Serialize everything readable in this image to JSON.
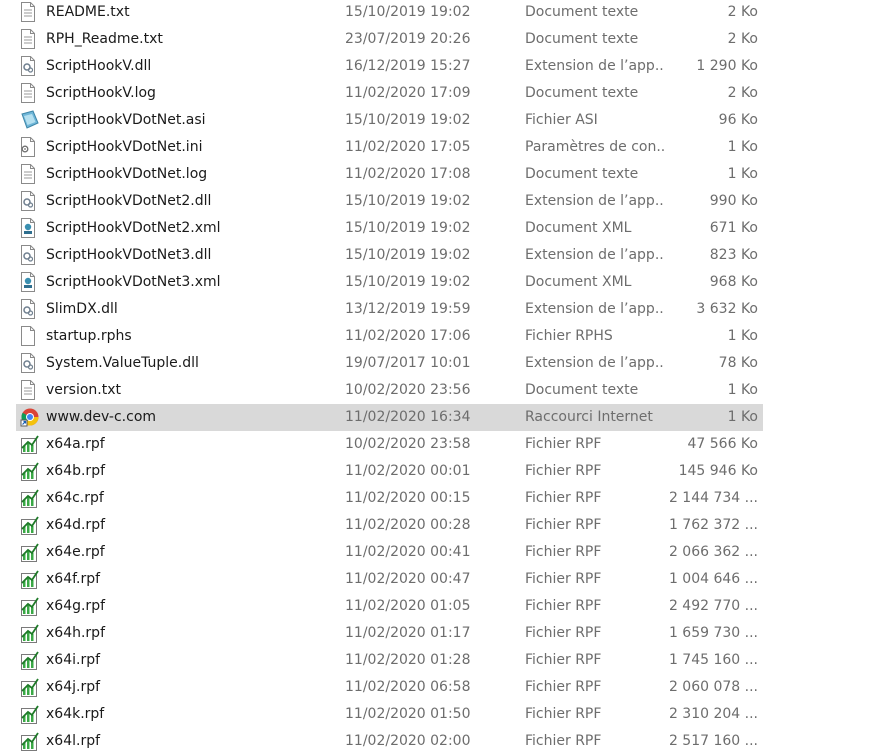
{
  "files": [
    {
      "name": "README.txt",
      "date": "15/10/2019 19:02",
      "type": "Document texte",
      "size": "2 Ko",
      "icon": "text-file-icon"
    },
    {
      "name": "RPH_Readme.txt",
      "date": "23/07/2019 20:26",
      "type": "Document texte",
      "size": "2 Ko",
      "icon": "text-file-icon"
    },
    {
      "name": "ScriptHookV.dll",
      "date": "16/12/2019 15:27",
      "type": "Extension de l’app...",
      "size": "1 290 Ko",
      "icon": "dll-file-icon"
    },
    {
      "name": "ScriptHookV.log",
      "date": "11/02/2020 17:09",
      "type": "Document texte",
      "size": "2 Ko",
      "icon": "text-file-icon"
    },
    {
      "name": "ScriptHookVDotNet.asi",
      "date": "15/10/2019 19:02",
      "type": "Fichier ASI",
      "size": "96 Ko",
      "icon": "asi-file-icon"
    },
    {
      "name": "ScriptHookVDotNet.ini",
      "date": "11/02/2020 17:05",
      "type": "Paramètres de con...",
      "size": "1 Ko",
      "icon": "ini-file-icon"
    },
    {
      "name": "ScriptHookVDotNet.log",
      "date": "11/02/2020 17:08",
      "type": "Document texte",
      "size": "1 Ko",
      "icon": "text-file-icon"
    },
    {
      "name": "ScriptHookVDotNet2.dll",
      "date": "15/10/2019 19:02",
      "type": "Extension de l’app...",
      "size": "990 Ko",
      "icon": "dll-file-icon"
    },
    {
      "name": "ScriptHookVDotNet2.xml",
      "date": "15/10/2019 19:02",
      "type": "Document XML",
      "size": "671 Ko",
      "icon": "xml-file-icon"
    },
    {
      "name": "ScriptHookVDotNet3.dll",
      "date": "15/10/2019 19:02",
      "type": "Extension de l’app...",
      "size": "823 Ko",
      "icon": "dll-file-icon"
    },
    {
      "name": "ScriptHookVDotNet3.xml",
      "date": "15/10/2019 19:02",
      "type": "Document XML",
      "size": "968 Ko",
      "icon": "xml-file-icon"
    },
    {
      "name": "SlimDX.dll",
      "date": "13/12/2019 19:59",
      "type": "Extension de l’app...",
      "size": "3 632 Ko",
      "icon": "dll-file-icon"
    },
    {
      "name": "startup.rphs",
      "date": "11/02/2020 17:06",
      "type": "Fichier RPHS",
      "size": "1 Ko",
      "icon": "blank-file-icon"
    },
    {
      "name": "System.ValueTuple.dll",
      "date": "19/07/2017 10:01",
      "type": "Extension de l’app...",
      "size": "78 Ko",
      "icon": "dll-file-icon"
    },
    {
      "name": "version.txt",
      "date": "10/02/2020 23:56",
      "type": "Document texte",
      "size": "1 Ko",
      "icon": "text-file-icon"
    },
    {
      "name": "www.dev-c.com",
      "date": "11/02/2020 16:34",
      "type": "Raccourci Internet",
      "size": "1 Ko",
      "icon": "chrome-shortcut-icon",
      "selected": true
    },
    {
      "name": "x64a.rpf",
      "date": "10/02/2020 23:58",
      "type": "Fichier RPF",
      "size": "47 566 Ko",
      "icon": "rpf-file-icon"
    },
    {
      "name": "x64b.rpf",
      "date": "11/02/2020 00:01",
      "type": "Fichier RPF",
      "size": "145 946 Ko",
      "icon": "rpf-file-icon"
    },
    {
      "name": "x64c.rpf",
      "date": "11/02/2020 00:15",
      "type": "Fichier RPF",
      "size": "2 144 734 ...",
      "icon": "rpf-file-icon"
    },
    {
      "name": "x64d.rpf",
      "date": "11/02/2020 00:28",
      "type": "Fichier RPF",
      "size": "1 762 372 ...",
      "icon": "rpf-file-icon"
    },
    {
      "name": "x64e.rpf",
      "date": "11/02/2020 00:41",
      "type": "Fichier RPF",
      "size": "2 066 362 ...",
      "icon": "rpf-file-icon"
    },
    {
      "name": "x64f.rpf",
      "date": "11/02/2020 00:47",
      "type": "Fichier RPF",
      "size": "1 004 646 ...",
      "icon": "rpf-file-icon"
    },
    {
      "name": "x64g.rpf",
      "date": "11/02/2020 01:05",
      "type": "Fichier RPF",
      "size": "2 492 770 ...",
      "icon": "rpf-file-icon"
    },
    {
      "name": "x64h.rpf",
      "date": "11/02/2020 01:17",
      "type": "Fichier RPF",
      "size": "1 659 730 ...",
      "icon": "rpf-file-icon"
    },
    {
      "name": "x64i.rpf",
      "date": "11/02/2020 01:28",
      "type": "Fichier RPF",
      "size": "1 745 160 ...",
      "icon": "rpf-file-icon"
    },
    {
      "name": "x64j.rpf",
      "date": "11/02/2020 06:58",
      "type": "Fichier RPF",
      "size": "2 060 078 ...",
      "icon": "rpf-file-icon"
    },
    {
      "name": "x64k.rpf",
      "date": "11/02/2020 01:50",
      "type": "Fichier RPF",
      "size": "2 310 204 ...",
      "icon": "rpf-file-icon"
    },
    {
      "name": "x64l.rpf",
      "date": "11/02/2020 02:00",
      "type": "Fichier RPF",
      "size": "2 517 160 ...",
      "icon": "rpf-file-icon"
    }
  ],
  "colors": {
    "selected_row": "#d9d9d9",
    "name_text": "#1a1a1a",
    "detail_text": "#6d6d6d"
  }
}
